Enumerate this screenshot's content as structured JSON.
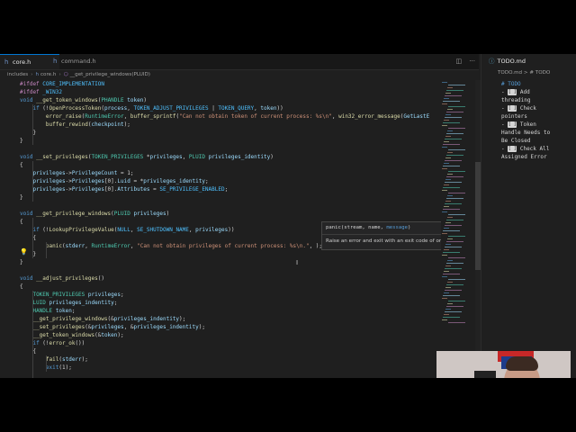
{
  "tabs": [
    {
      "label": "core.h",
      "icon": "h",
      "active": true
    },
    {
      "label": "command.h",
      "icon": "h",
      "active": false
    }
  ],
  "tab_actions": [
    "split-editor-icon",
    "more-icon"
  ],
  "breadcrumb": {
    "parts": [
      "includes",
      "core.h",
      "__get_privilege_windows(PLUID)"
    ]
  },
  "code_lines": [
    "#ifdef CORE_IMPLEMENTATION",
    "#ifdef _WIN32",
    "void __get_token_windows(PHANDLE token)",
    "    if (!OpenProcessToken(process, TOKEN_ADJUST_PRIVILEGES | TOKEN_QUERY, token))",
    "        error_raise(RuntimeError, buffer_sprintf(\"Can not obtain token of current process: %s\\n\", win32_error_message(GetLastE",
    "        buffer_rewind(checkpoint);",
    "    }",
    "}",
    "void __set_privileges(TOKEN_PRIVILEGES *privileges, PLUID privileges_identity)",
    "{",
    "    privileges->PrivilegeCount = 1;",
    "    privileges->Privileges[0].Luid = *privileges_identity;",
    "    privileges->Privileges[0].Attributes = SE_PRIVILEGE_ENABLED;",
    "}",
    "void __get_privilege_windows(PLUID privileges)",
    "{",
    "    if (!LookupPrivilegeValue(NULL, SE_SHUTDOWN_NAME, privileges))",
    "    {",
    "        panic(stderr, RuntimeError, \"Can not obtain privileges of current process: %s\\n.\", );",
    "    }",
    "}",
    "void __adjust_privileges()",
    "{",
    "    TOKEN_PRIVILEGES privileges;",
    "    LUID privileges_indentity;",
    "    HANDLE token;",
    "    __get_privilege_windows(&privileges_indentity);",
    "    __set_privileges(&privileges, &privileges_indentity);",
    "    __get_token_windows(&token);",
    "    if (!error_ok())",
    "    {",
    "        fail(stderr);",
    "        exit(1);"
  ],
  "hover": {
    "signature": "panic(stream, name, message)",
    "signature_prefix": "panic(stream, name, ",
    "signature_param": "message",
    "signature_suffix": ")",
    "doc": "Raise an error and exit with an exit code of one."
  },
  "right_pane": {
    "tab_label": "TODO.md",
    "breadcrumb": "TODO.md > # TODO",
    "lines": [
      {
        "kind": "heading",
        "text": "# TODO"
      },
      {
        "kind": "item",
        "text": "- [ ] Add",
        "cont": "threading"
      },
      {
        "kind": "item",
        "text": "- [ ] Check",
        "cont": "pointers"
      },
      {
        "kind": "item",
        "text": "- [ ] Token",
        "cont": "Handle Needs to"
      },
      {
        "kind": "cont",
        "text": "Be Closed"
      },
      {
        "kind": "item",
        "text": "- [ ] Check All",
        "cont": "Assigned Error"
      }
    ]
  },
  "colors": {
    "editor_bg": "#1f1f1f",
    "keyword": "#569cd6",
    "type": "#4ec9b0",
    "function": "#dcdcaa",
    "string": "#ce9178",
    "variable": "#9cdcfe",
    "accent": "#0078d4"
  }
}
